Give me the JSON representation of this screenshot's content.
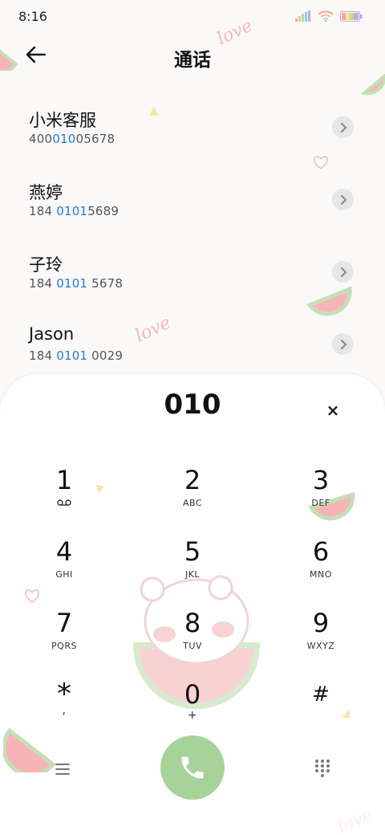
{
  "status_bar": {
    "time": "8:16"
  },
  "header": {
    "title": "通话",
    "back_icon": "arrow-left-icon"
  },
  "results": [
    {
      "name": "小米客服",
      "number_parts": [
        "400",
        "010",
        "05678"
      ]
    },
    {
      "name": "燕婷",
      "number_parts": [
        "184 ",
        "0101",
        "5689"
      ]
    },
    {
      "name": "子玲",
      "number_parts": [
        "184 ",
        "0101",
        " 5678"
      ]
    },
    {
      "name": "Jason",
      "number_parts": [
        "184 ",
        "0101",
        " 0029"
      ]
    }
  ],
  "dialer": {
    "input": "010",
    "clear_label": "×",
    "keys": [
      {
        "digit": "1",
        "letters": ""
      },
      {
        "digit": "2",
        "letters": "ABC"
      },
      {
        "digit": "3",
        "letters": "DEF"
      },
      {
        "digit": "4",
        "letters": "GHI"
      },
      {
        "digit": "5",
        "letters": "JKL"
      },
      {
        "digit": "6",
        "letters": "MNO"
      },
      {
        "digit": "7",
        "letters": "PQRS"
      },
      {
        "digit": "8",
        "letters": "TUV"
      },
      {
        "digit": "9",
        "letters": "WXYZ"
      },
      {
        "digit": "*",
        "letters": ","
      },
      {
        "digit": "0",
        "letters": "+"
      },
      {
        "digit": "#",
        "letters": ""
      }
    ]
  },
  "colors": {
    "highlight": "#1a7fd4",
    "call_button": "#a6d39a",
    "panel": "#ffffff"
  },
  "decor": {
    "love_text": "love"
  }
}
